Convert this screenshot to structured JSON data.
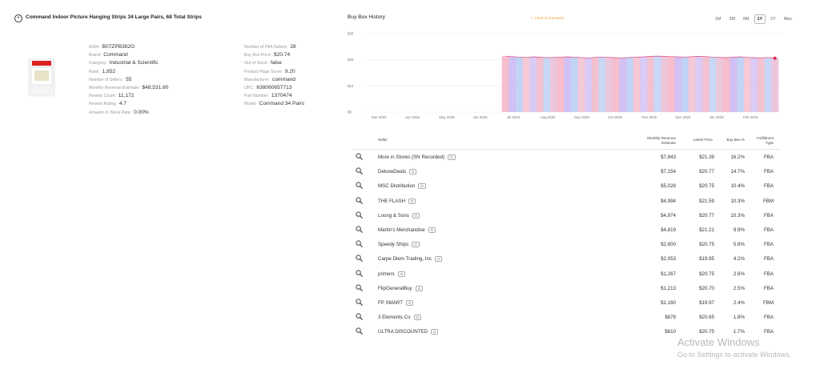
{
  "product": {
    "title": "Command Indoor Picture Hanging Strips 34 Large Pairs, 68 Total Strips",
    "col1": [
      {
        "k": "ASIN:",
        "v": "B07ZPB382G"
      },
      {
        "k": "Brand:",
        "v": "Command"
      },
      {
        "k": "Category:",
        "v": "Industrial & Scientific"
      },
      {
        "k": "Rank:",
        "v": "1,852"
      },
      {
        "k": "Number of Sellers:",
        "v": "55"
      },
      {
        "k": "Monthly Revenue Estimate:",
        "v": "$48,531.60"
      },
      {
        "k": "Review Count:",
        "v": "11,172"
      },
      {
        "k": "Review Rating:",
        "v": "4.7"
      },
      {
        "k": "Amazon In Stock Rate:",
        "v": "0.00%"
      }
    ],
    "col2": [
      {
        "k": "Number of FBA Sellers:",
        "v": "28"
      },
      {
        "k": "Buy Box Price:",
        "v": "$20.74"
      },
      {
        "k": "Out of Stock:",
        "v": "false"
      },
      {
        "k": "Product Page Score:",
        "v": "9.20"
      },
      {
        "k": "Manufacturer:",
        "v": "command"
      },
      {
        "k": "UPC:",
        "v": "638060657713"
      },
      {
        "k": "Part Number:",
        "v": "1370474"
      },
      {
        "k": "Model:",
        "v": "Command 34 Pairs"
      }
    ]
  },
  "chart_title": "Buy Box History",
  "chart_warning": "⚠ Chart is truncated",
  "ranges": [
    "1M",
    "3M",
    "6M",
    "1Y",
    "2Y",
    "Max"
  ],
  "active_range": "1Y",
  "chart_data": {
    "type": "bar",
    "title": "Buy Box History",
    "y_ticks": [
      "$0",
      "$10",
      "$20",
      "$30"
    ],
    "ylim": [
      0,
      30
    ],
    "x_ticks": [
      "Mar 2025",
      "Apr 2025",
      "May 2025",
      "Jun 2025",
      "Jul 2025",
      "Aug 2025",
      "Sep 2025",
      "Oct 2025",
      "Nov 2025",
      "Dec 2025",
      "Jan 2026",
      "Feb 2026"
    ],
    "data_start_month_index": 4.0,
    "values": [
      21.4,
      21.2,
      21.0,
      20.9,
      21.1,
      21.0,
      20.8,
      20.9,
      21.0,
      21.1,
      21.0,
      20.8,
      20.7,
      20.9,
      21.0,
      20.9,
      20.8,
      20.7,
      20.9,
      21.0,
      21.1,
      21.3,
      21.4,
      21.3,
      21.2,
      21.1,
      21.0,
      21.2,
      21.3,
      21.2,
      21.0,
      20.9,
      20.8,
      21.0,
      21.1,
      20.9,
      20.8,
      20.7,
      20.9,
      20.6
    ],
    "grid": true
  },
  "table": {
    "headers": {
      "seller": "Seller",
      "revenue_line1": "Monthly Revenue",
      "revenue_line2": "Estimate",
      "price": "Latest Price",
      "buybox": "Buy Box %",
      "fulfill_line1": "Fulfillment",
      "fulfill_line2": "Type"
    },
    "rows": [
      {
        "seller": "More in Stores (SN Recorded)",
        "revenue": "$7,843",
        "price": "$21.39",
        "buybox": "16.2%",
        "type": "FBA"
      },
      {
        "seller": "DeluxeDeals",
        "revenue": "$7,154",
        "price": "$20.77",
        "buybox": "14.7%",
        "type": "FBA"
      },
      {
        "seller": "MSC Distribution",
        "revenue": "$5,028",
        "price": "$20.75",
        "buybox": "10.4%",
        "type": "FBA"
      },
      {
        "seller": "THE FLASH",
        "revenue": "$4,994",
        "price": "$21.59",
        "buybox": "10.3%",
        "type": "FBM"
      },
      {
        "seller": "Loong & Sons",
        "revenue": "$4,974",
        "price": "$20.77",
        "buybox": "10.3%",
        "type": "FBA"
      },
      {
        "seller": "Martin's Merchandise",
        "revenue": "$4,819",
        "price": "$21.21",
        "buybox": "9.9%",
        "type": "FBA"
      },
      {
        "seller": "Speedy Ships",
        "revenue": "$2,800",
        "price": "$20.75",
        "buybox": "5.8%",
        "type": "FBA"
      },
      {
        "seller": "Carpe Diem Trading, Inc",
        "revenue": "$2,053",
        "price": "$19.95",
        "buybox": "4.2%",
        "type": "FBA"
      },
      {
        "seller": "primers",
        "revenue": "$1,267",
        "price": "$20.75",
        "buybox": "2.6%",
        "type": "FBA"
      },
      {
        "seller": "FlipGeneralBuy",
        "revenue": "$1,213",
        "price": "$20.70",
        "buybox": "2.5%",
        "type": "FBA"
      },
      {
        "seller": "FP SMART",
        "revenue": "$1,160",
        "price": "$19.97",
        "buybox": "2.4%",
        "type": "FBM"
      },
      {
        "seller": "3 Elements Co",
        "revenue": "$878",
        "price": "$20.65",
        "buybox": "1.8%",
        "type": "FBA"
      },
      {
        "seller": "ULTRA DISCOUNTED",
        "revenue": "$810",
        "price": "$20.75",
        "buybox": "1.7%",
        "type": "FBA"
      }
    ]
  },
  "watermark": {
    "line1": "Activate Windows",
    "line2": "Go to Settings to activate Windows."
  }
}
